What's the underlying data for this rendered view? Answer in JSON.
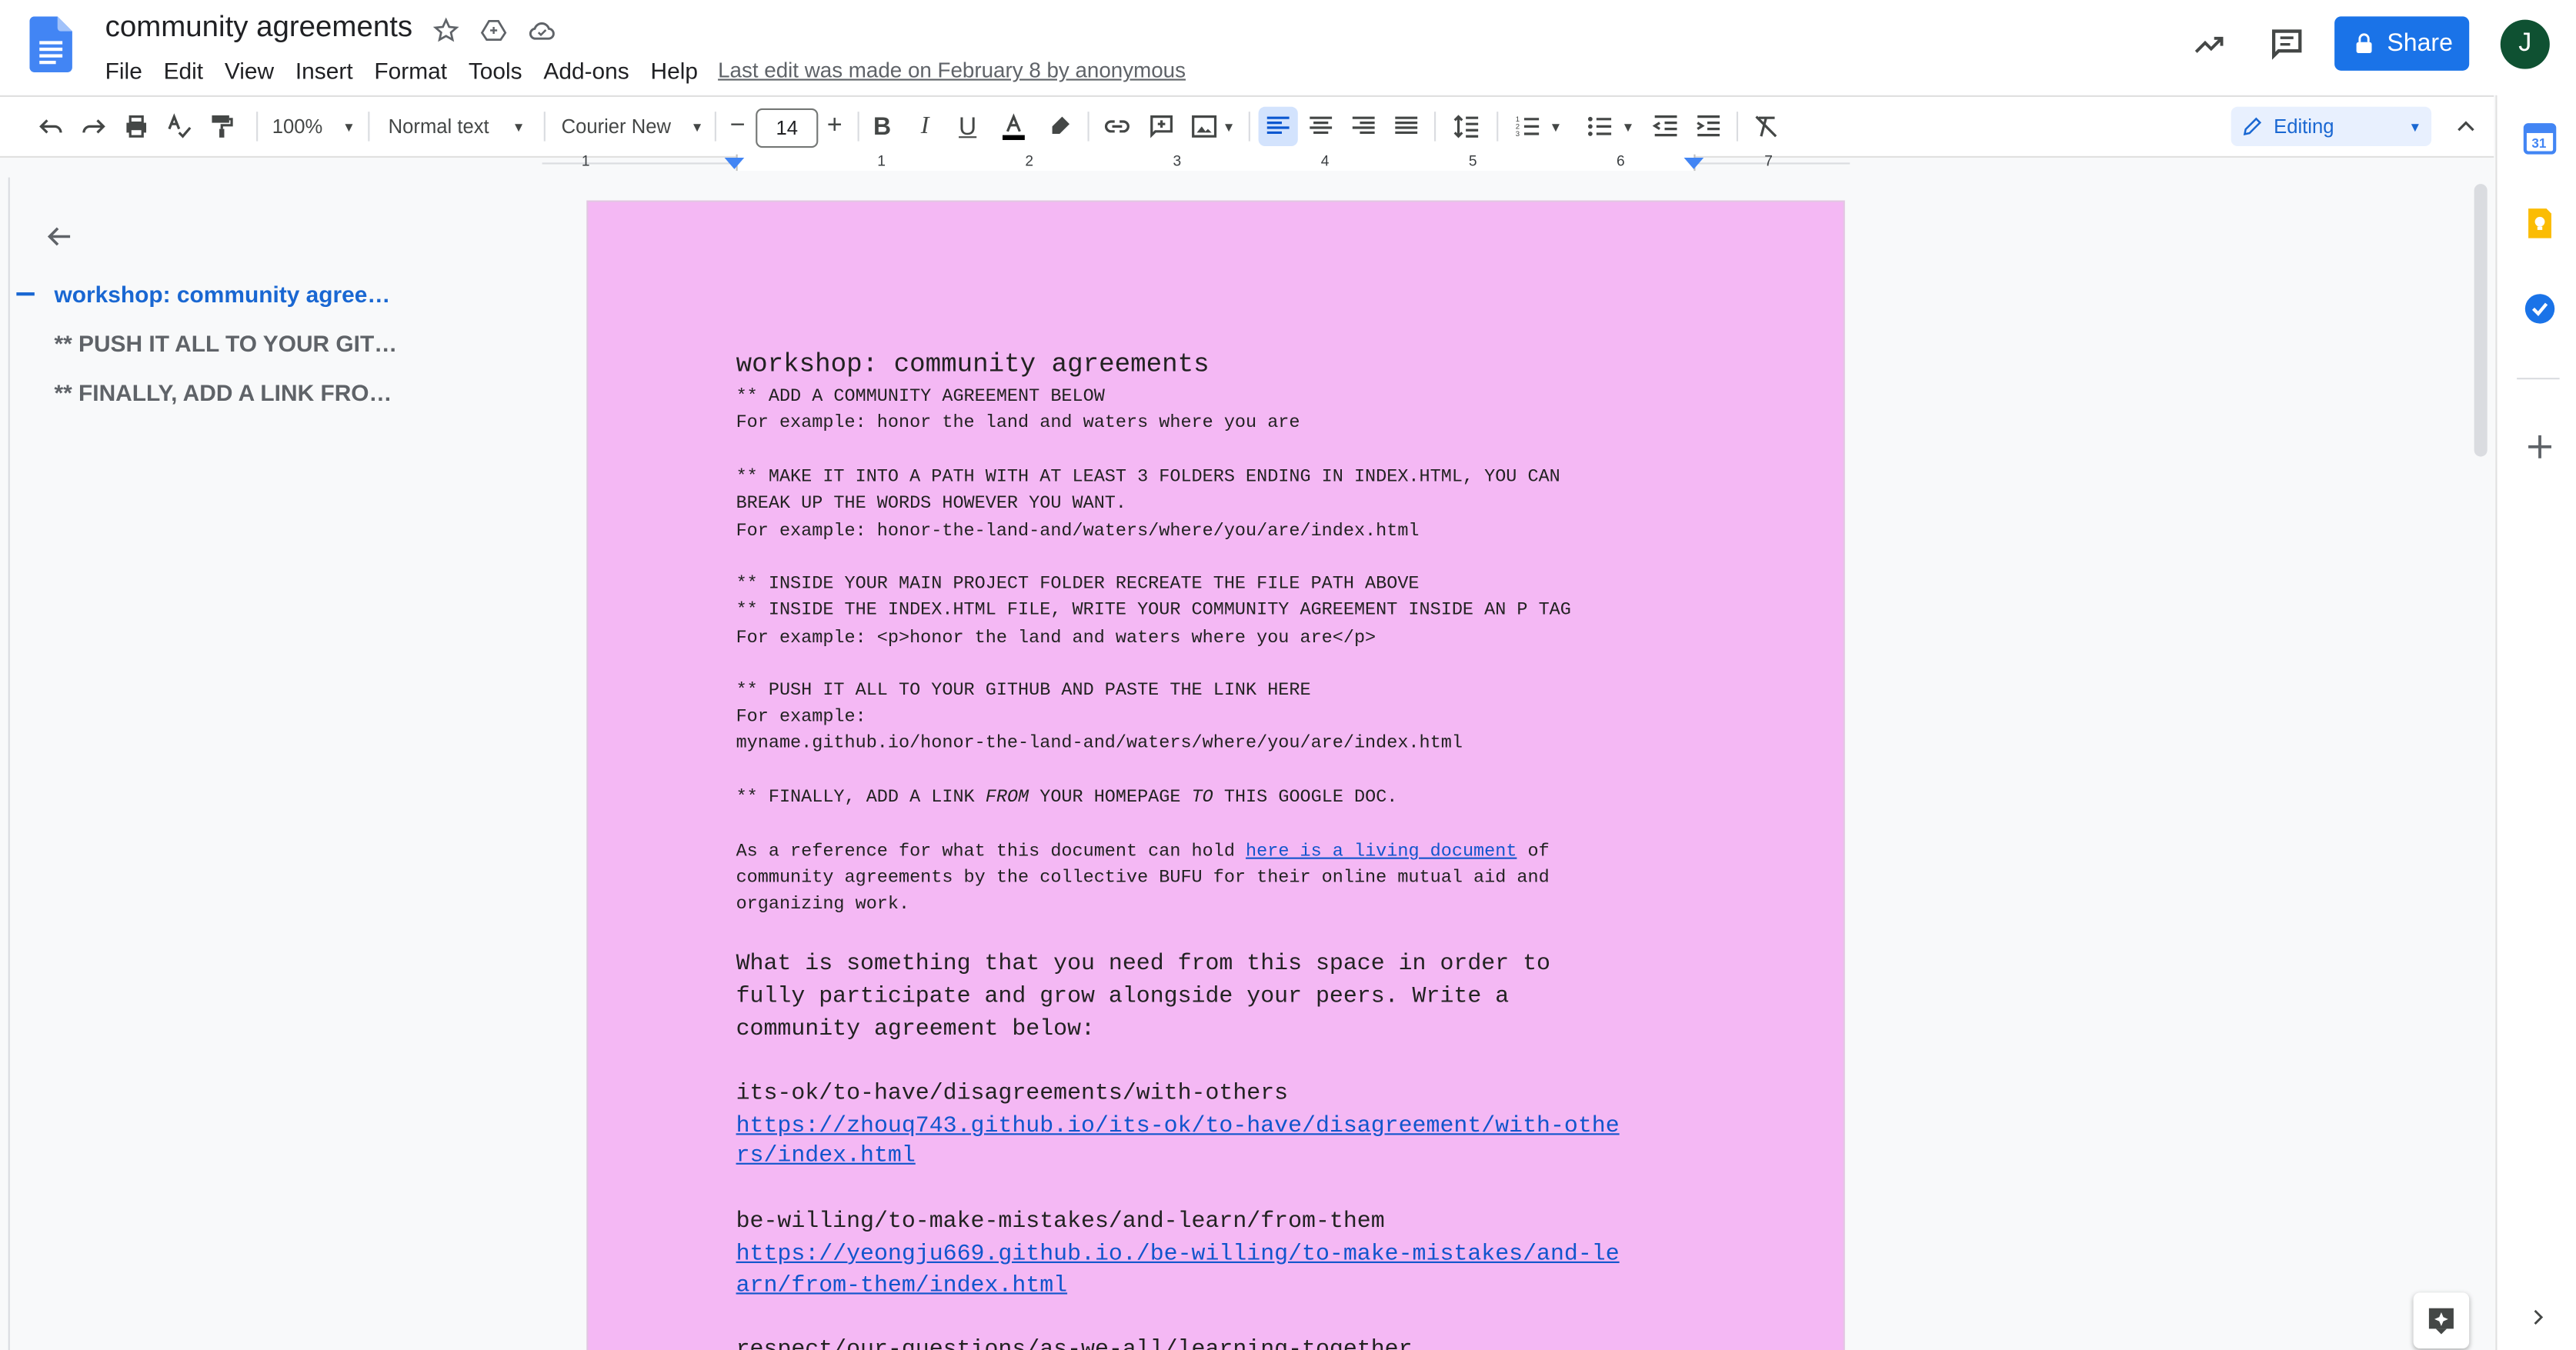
{
  "doc": {
    "title": "community agreements",
    "menu": [
      "File",
      "Edit",
      "View",
      "Insert",
      "Format",
      "Tools",
      "Add-ons",
      "Help"
    ],
    "last_edit": "Last edit was made on February 8 by anonymous"
  },
  "header": {
    "share_label": "Share",
    "avatar_letter": "J"
  },
  "toolbar": {
    "zoom": "100%",
    "style": "Normal text",
    "font": "Courier New",
    "font_size": "14",
    "mode": "Editing"
  },
  "ruler": {
    "labels": [
      "1",
      "1",
      "2",
      "3",
      "4",
      "5",
      "6",
      "7"
    ]
  },
  "outline": {
    "items": [
      "workshop: community agree…",
      "** PUSH IT ALL TO YOUR GIT…",
      "** FINALLY, ADD A LINK FRO…"
    ]
  },
  "page": {
    "heading": "workshop: community agreements",
    "l1": "** ADD A COMMUNITY AGREEMENT BELOW",
    "l2": "For example: honor the land and waters where you are",
    "l3": "** MAKE IT INTO A PATH WITH AT LEAST 3 FOLDERS ENDING IN INDEX.HTML, YOU CAN",
    "l4": "BREAK UP THE WORDS HOWEVER YOU WANT.",
    "l5": "For example: honor-the-land-and/waters/where/you/are/index.html",
    "l6": "** INSIDE YOUR MAIN PROJECT FOLDER RECREATE THE FILE PATH ABOVE",
    "l7": "** INSIDE THE INDEX.HTML FILE, WRITE YOUR COMMUNITY AGREEMENT INSIDE AN P TAG",
    "l8": "For example: <p>honor the land and waters where you are</p>",
    "l9": "** PUSH IT ALL TO YOUR GITHUB AND PASTE THE LINK HERE",
    "l10": "For example:",
    "l11": "myname.github.io/honor-the-land-and/waters/where/you/are/index.html",
    "l12a": "** FINALLY, ADD A LINK ",
    "l12b": "FROM",
    "l12c": " YOUR HOMEPAGE ",
    "l12d": "TO",
    "l12e": " THIS GOOGLE DOC.",
    "ref_a": "As a reference for what this document can hold ",
    "ref_link": "here is a living document",
    "ref_b": " of",
    "ref2": "community agreements by the collective BUFU for their online mutual aid and",
    "ref3": "organizing work.",
    "q1": "What is something that you need from this space in order to",
    "q2": "fully participate and grow alongside your peers. Write a",
    "q3": "community agreement below:",
    "e1": "its-ok/to-have/disagreements/with-others",
    "e1_link1": "https://zhouq743.github.io/its-ok/to-have/disagreement/with-othe",
    "e1_link2": "rs/index.html",
    "e2": "be-willing/to-make-mistakes/and-learn/from-them",
    "e2_link1": "https://yeongju669.github.io./be-willing/to-make-mistakes/and-le",
    "e2_link2": "arn/from-them/index.html",
    "e3": "respect/our-questions/as-we-all/learning-together"
  },
  "colors": {
    "page_bg": "#f4b8f4",
    "accent": "#1a73e8",
    "link": "#1155cc"
  }
}
